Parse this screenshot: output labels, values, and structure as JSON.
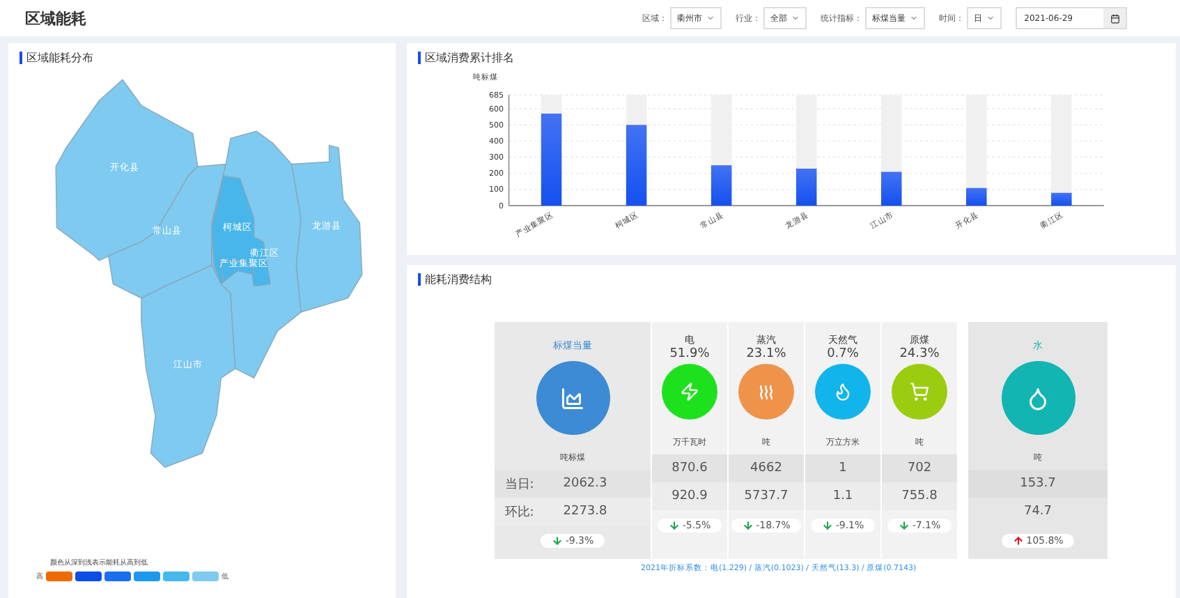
{
  "header": {
    "title": "区域能耗",
    "filters": [
      {
        "label": "区域：",
        "value": "衢州市",
        "kind": "select"
      },
      {
        "label": "行业：",
        "value": "全部",
        "kind": "select"
      },
      {
        "label": "统计指标：",
        "value": "标煤当量",
        "kind": "select"
      },
      {
        "label": "时间：",
        "value": "日",
        "kind": "select"
      },
      {
        "value": "2021-06-29",
        "kind": "date"
      }
    ]
  },
  "map_panel": {
    "title": "区域能耗分布",
    "regions": [
      {
        "name": "开化县",
        "color": "#7ecaf0"
      },
      {
        "name": "常山县",
        "color": "#7ecaf0"
      },
      {
        "name": "江山市",
        "color": "#7ecaf0"
      },
      {
        "name": "衢江区",
        "color": "#7ecaf0"
      },
      {
        "name": "龙游县",
        "color": "#7ecaf0"
      },
      {
        "name": "柯城区",
        "color": "#48b6ea"
      },
      {
        "name": "产业集聚区",
        "color": "#48b6ea"
      }
    ],
    "legend": {
      "caption": "颜色从深到浅表示能耗从高到低",
      "high": "高",
      "low": "低",
      "swatches": [
        {
          "color": "#ee6a00"
        },
        {
          "color": "#0a4de8"
        },
        {
          "color": "#1a6ff0"
        },
        {
          "color": "#1e98ec"
        },
        {
          "color": "#46b8ee"
        },
        {
          "color": "#7ecaf0"
        }
      ]
    }
  },
  "ranking_panel": {
    "title": "区域消费累计排名",
    "chart_data": {
      "type": "bar",
      "ylabel": "吨标煤",
      "categories": [
        "产业集聚区",
        "柯城区",
        "常山县",
        "龙游县",
        "江山市",
        "开化县",
        "衢江区"
      ],
      "stacked": true,
      "series": [
        {
          "color": "#1450f0",
          "values": [
            570,
            500,
            250,
            230,
            210,
            110,
            80
          ]
        },
        {
          "color": "#f0f0f0",
          "values": [
            115,
            185,
            435,
            455,
            475,
            575,
            605
          ]
        }
      ],
      "ylim": [
        0,
        685
      ],
      "grid": true,
      "yticks": [
        0,
        100,
        200,
        300,
        400,
        500,
        600,
        685
      ]
    }
  },
  "structure_panel": {
    "title": "能耗消费结构",
    "cards": [
      {
        "kind": "primary",
        "name": "标煤当量",
        "unit": "吨标煤",
        "today_label": "当日:",
        "today": "2062.3",
        "prev_label": "环比:",
        "prev": "2273.8",
        "change": "-9.3%",
        "rising": false,
        "color": "#3d8bd4"
      },
      {
        "kind": "item",
        "name": "电",
        "share": "51.9%",
        "unit": "万千瓦时",
        "today": "870.6",
        "prev": "920.9",
        "change": "-5.5%",
        "rising": false,
        "color": "#1ee11e"
      },
      {
        "kind": "item",
        "name": "蒸汽",
        "share": "23.1%",
        "unit": "吨",
        "today": "4662",
        "prev": "5737.7",
        "change": "-18.7%",
        "rising": false,
        "color": "#f0934a"
      },
      {
        "kind": "item",
        "name": "天然气",
        "share": "0.7%",
        "unit": "万立方米",
        "today": "1",
        "prev": "1.1",
        "change": "-9.1%",
        "rising": false,
        "color": "#12b4ec"
      },
      {
        "kind": "item",
        "name": "原煤",
        "share": "24.3%",
        "unit": "吨",
        "today": "702",
        "prev": "755.8",
        "change": "-7.1%",
        "rising": false,
        "color": "#9ccc10"
      },
      {
        "kind": "water",
        "name": "水",
        "unit": "吨",
        "today": "153.7",
        "prev": "74.7",
        "change": "105.8%",
        "rising": true,
        "color": "#12b5b2"
      }
    ],
    "footnote": "2021年折标系数：电(1.229) / 蒸汽(0.1023) / 天然气(13.3) / 原煤(0.7143)"
  }
}
